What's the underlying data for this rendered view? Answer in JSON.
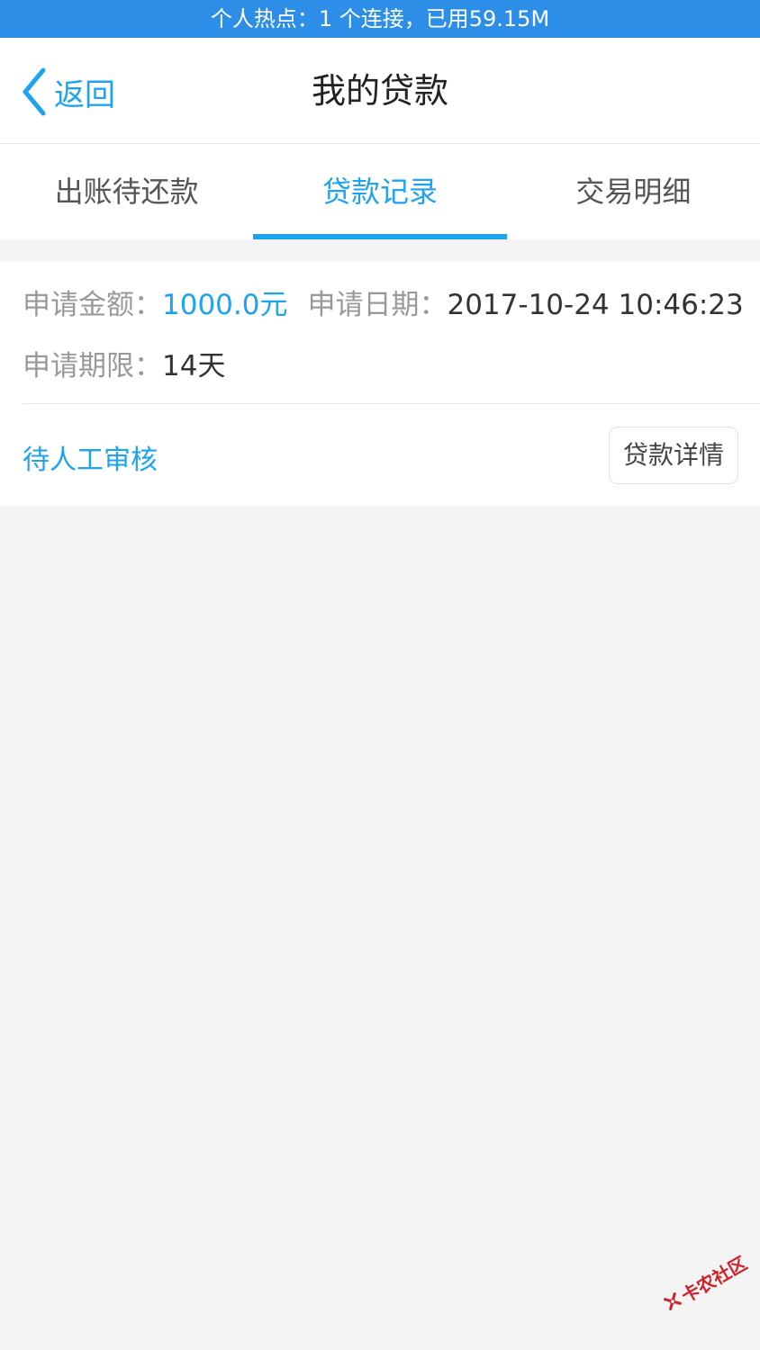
{
  "status_bar": {
    "text": "个人热点：1 个连接，已用59.15M"
  },
  "nav": {
    "back_label": "返回",
    "title": "我的贷款"
  },
  "tabs": [
    {
      "label": "出账待还款",
      "active": false
    },
    {
      "label": "贷款记录",
      "active": true
    },
    {
      "label": "交易明细",
      "active": false
    }
  ],
  "record": {
    "amount_label": "申请金额：",
    "amount_value": "1000.0元",
    "date_label": "申请日期：",
    "date_value": "2017-10-24 10:46:23",
    "term_label": "申请期限：",
    "term_value": "14天",
    "status": "待人工审核",
    "detail_button": "贷款详情"
  },
  "watermark": {
    "text": "卡农社区"
  },
  "colors": {
    "accent": "#1ea3f0",
    "status_bar": "#2d8ee8",
    "watermark": "#d0202a"
  }
}
